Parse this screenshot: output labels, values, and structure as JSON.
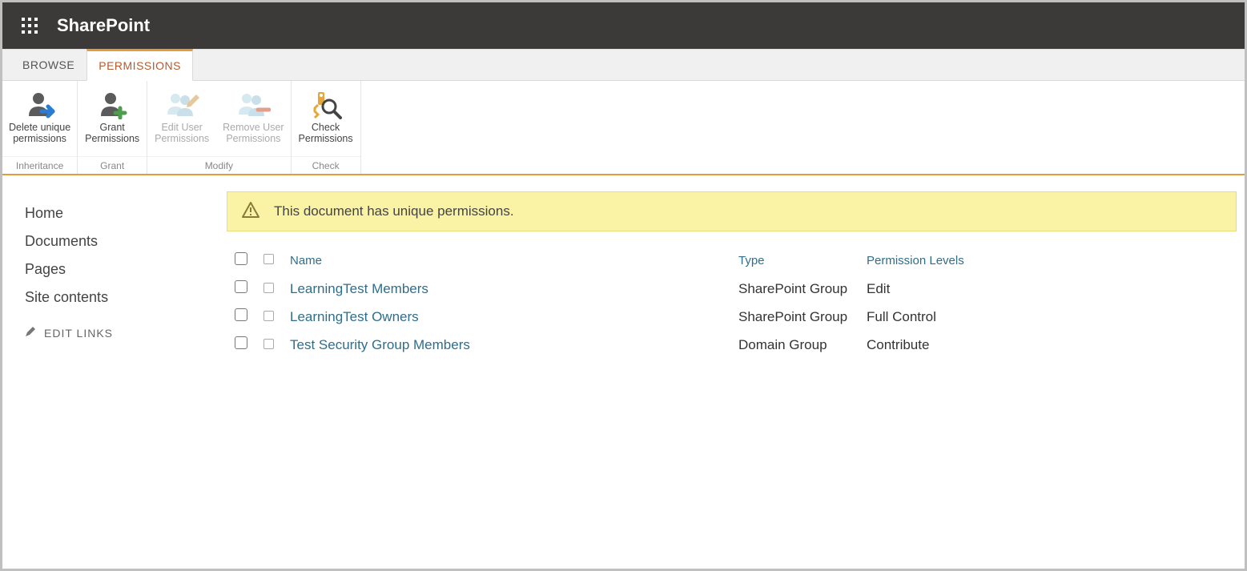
{
  "brand": "SharePoint",
  "tabs": {
    "browse": "BROWSE",
    "permissions": "PERMISSIONS"
  },
  "ribbon": {
    "delete_unique": {
      "line1": "Delete unique",
      "line2": "permissions"
    },
    "grant": {
      "line1": "Grant",
      "line2": "Permissions"
    },
    "edit_user": {
      "line1": "Edit User",
      "line2": "Permissions"
    },
    "remove_user": {
      "line1": "Remove User",
      "line2": "Permissions"
    },
    "check": {
      "line1": "Check",
      "line2": "Permissions"
    },
    "group_inheritance": "Inheritance",
    "group_grant": "Grant",
    "group_modify": "Modify",
    "group_check": "Check"
  },
  "sidenav": {
    "home": "Home",
    "documents": "Documents",
    "pages": "Pages",
    "site_contents": "Site contents",
    "edit_links": "EDIT LINKS"
  },
  "notice": "This document has unique permissions.",
  "table": {
    "headers": {
      "name": "Name",
      "type": "Type",
      "level": "Permission Levels"
    },
    "rows": [
      {
        "name": "LearningTest Members",
        "type": "SharePoint Group",
        "level": "Edit"
      },
      {
        "name": "LearningTest Owners",
        "type": "SharePoint Group",
        "level": "Full Control"
      },
      {
        "name": "Test Security Group Members",
        "type": "Domain Group",
        "level": "Contribute"
      }
    ]
  }
}
